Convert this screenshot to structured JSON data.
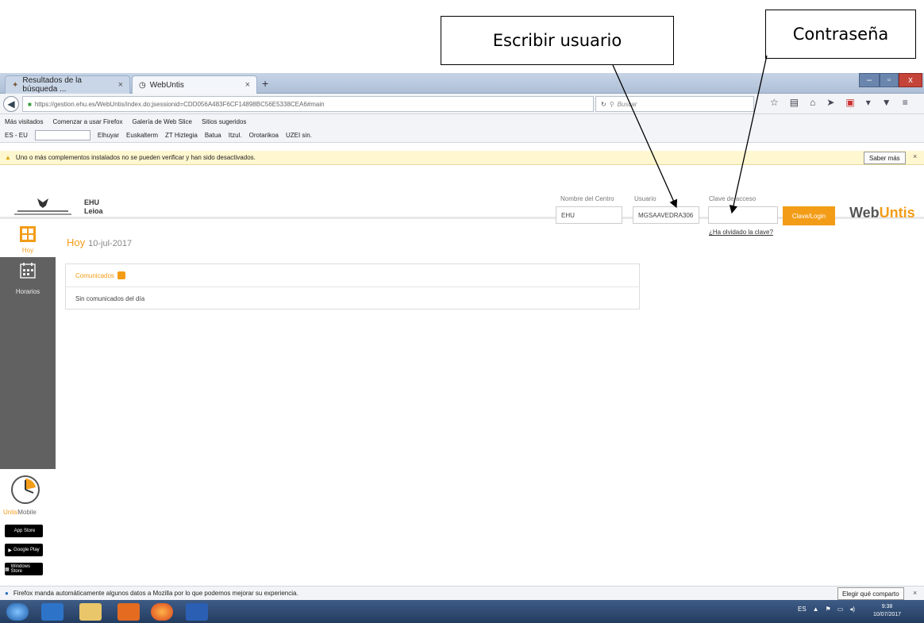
{
  "annotations": {
    "user_callout": "Escribir usuario",
    "password_callout": "Contraseña"
  },
  "browser": {
    "tabs": [
      {
        "label": "Resultados de la búsqueda ...",
        "close": "×"
      },
      {
        "label": "WebUntis",
        "close": "×"
      }
    ],
    "new_tab": "+",
    "url": "https://gestion.ehu.es/WebUntis/index.do;jsessionid=CDD056A483F6CF14898BC56E5338CEA6#main",
    "url_host": "gestion.ehu.es",
    "search_placeholder": "Buscar",
    "bookmarks": [
      "Más visitados",
      "Comenzar a usar Firefox",
      "Galería de Web Slice",
      "Sitios sugeridos"
    ],
    "lang_selector": "ES - EU",
    "lang_links": [
      "Elhuyar",
      "Euskalterm",
      "ZT Hiztegia",
      "Batua",
      "Itzul.",
      "Orotarikoa",
      "UZEI sin."
    ],
    "notice": "Uno o más complementos instalados no se pueden verificar y han sido desactivados.",
    "learn_more": "Saber más",
    "close": "×"
  },
  "header": {
    "school_name": "EHU",
    "school_location": "Leioa",
    "center_label": "Nombre del Centro",
    "center_value": "EHU",
    "user_label": "Usuario",
    "user_value": "MGSAAVEDRA306",
    "password_label": "Clave de acceso",
    "password_value": "",
    "login_button": "Clave/Login",
    "forgot_link": "¿Ha olvidado la clave?",
    "brand_prefix": "Web",
    "brand_accent": "Untis"
  },
  "sidebar": {
    "today": "Hoy",
    "schedule": "Horarios",
    "mobile_prefix": "Untis",
    "mobile_suffix": "Mobile",
    "app_store": "App Store",
    "google_play": "Google Play",
    "windows_store": "Windows Store"
  },
  "main": {
    "title": "Hoy",
    "date": "10-jul-2017",
    "news_title": "Comunicados",
    "news_empty": "Sin comunicados del día"
  },
  "status": {
    "message": "Firefox manda automáticamente algunos datos a Mozilla por lo que podemos mejorar su experiencia.",
    "choose_button": "Elegir qué comparto"
  },
  "taskbar": {
    "lang": "ES",
    "time": "9:38",
    "date": "10/07/2017"
  },
  "colors": {
    "accent": "#f39c17",
    "sidebar": "#616161",
    "taskbar": "#233c60"
  }
}
